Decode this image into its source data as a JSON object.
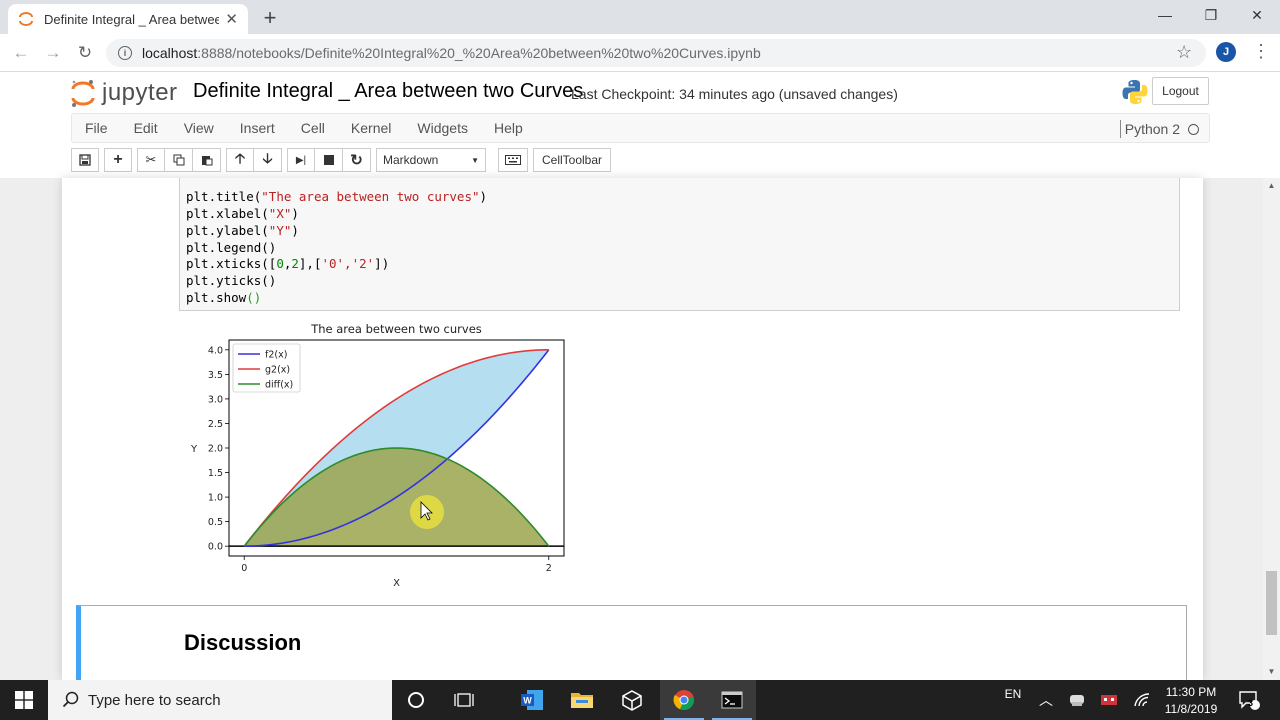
{
  "browser": {
    "tab_title": "Definite Integral _ Area between",
    "url_host": "localhost",
    "url_path": ":8888/notebooks/Definite%20Integral%20_%20Area%20between%20two%20Curves.ipynb",
    "profile_initial": "J"
  },
  "jupyter": {
    "logo_text": "jupyter",
    "notebook_name": "Definite Integral _ Area between two Curves",
    "checkpoint": "Last Checkpoint: 34 minutes ago (unsaved changes)",
    "logout": "Logout",
    "menu": [
      "File",
      "Edit",
      "View",
      "Insert",
      "Cell",
      "Kernel",
      "Widgets",
      "Help"
    ],
    "kernel": "Python 2",
    "cell_type": "Markdown",
    "celltoolbar": "CellToolbar"
  },
  "code_lines": [
    {
      "p1": "plt.title(",
      "s": "\"The area between two curves\"",
      "p2": ")"
    },
    {
      "p1": "plt.xlabel(",
      "s": "\"X\"",
      "p2": ")"
    },
    {
      "p1": "plt.ylabel(",
      "s": "\"Y\"",
      "p2": ")"
    },
    {
      "p1": "plt.legend()",
      "s": "",
      "p2": ""
    },
    {
      "p1": "plt.xticks([",
      "n1": "0",
      "c1": ",",
      "n2": "2",
      "c2": "],[",
      "s": "'0','2'",
      "p2": "])"
    },
    {
      "p1": "plt.yticks()",
      "s": "",
      "p2": ""
    },
    {
      "p1": "plt.show",
      "s": "",
      "p2": "",
      "paren": "()"
    }
  ],
  "chart_data": {
    "type": "area",
    "title": "The area between two curves",
    "xlabel": "X",
    "ylabel": "Y",
    "xlim": [
      -0.1,
      2.1
    ],
    "ylim": [
      -0.2,
      4.2
    ],
    "xticks": [
      0,
      2
    ],
    "xtick_labels": [
      "0",
      "2"
    ],
    "yticks": [
      0.0,
      0.5,
      1.0,
      1.5,
      2.0,
      2.5,
      3.0,
      3.5,
      4.0
    ],
    "ytick_labels": [
      "0.0",
      "0.5",
      "1.0",
      "1.5",
      "2.0",
      "2.5",
      "3.0",
      "3.5",
      "4.0"
    ],
    "legend_position": "top-left",
    "x": [
      0,
      0.25,
      0.5,
      0.75,
      1.0,
      1.25,
      1.5,
      1.75,
      2.0
    ],
    "series": [
      {
        "name": "f2(x)",
        "color": "#3333dd",
        "values": [
          0,
          0.0625,
          0.25,
          0.5625,
          1.0,
          1.5625,
          2.25,
          3.0625,
          4.0
        ]
      },
      {
        "name": "g2(x)",
        "color": "#e03c3c",
        "values": [
          0,
          0.9375,
          1.75,
          2.4375,
          3.0,
          3.4375,
          3.75,
          3.9375,
          4.0
        ]
      },
      {
        "name": "diff(x)",
        "color": "#2e8b2e",
        "values": [
          0,
          0.875,
          1.5,
          1.875,
          2.0,
          1.875,
          1.5,
          0.875,
          0
        ]
      }
    ],
    "fills": [
      {
        "between": [
          "f2(x)",
          "g2(x)"
        ],
        "color": "#a9d8ee"
      },
      {
        "between": [
          "zero",
          "diff(x)"
        ],
        "color": "#9ba44e"
      }
    ]
  },
  "markdown": {
    "heading": "Discussion"
  },
  "taskbar": {
    "search_placeholder": "Type here to search",
    "language": "EN",
    "time": "11:30 PM",
    "date": "11/8/2019",
    "notification_count": "3"
  }
}
